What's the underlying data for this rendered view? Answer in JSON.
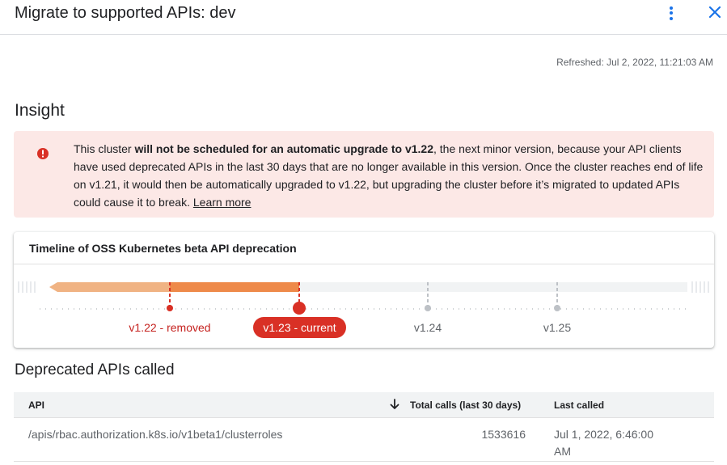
{
  "header": {
    "title": "Migrate to supported APIs: dev",
    "colors": {
      "accent": "#1a73e8"
    }
  },
  "refreshed": "Refreshed: Jul 2, 2022, 11:21:03 AM",
  "insight": {
    "title": "Insight",
    "alert": {
      "text_before": "This cluster ",
      "text_bold": "will not be scheduled for an automatic upgrade to v1.22",
      "text_after": ", the next minor version, because your API clients have used deprecated APIs in the last 30 days that are no longer available in this version. Once the cluster reaches end of life on v1.21, it would then be automatically upgraded to v1.22, but upgrading the cluster before it’s migrated to updated APIs could cause it to break. ",
      "link": "Learn more",
      "icon": "error-icon",
      "colors": {
        "background": "#fce8e6",
        "icon": "#d93025"
      }
    }
  },
  "timeline": {
    "title": "Timeline of OSS Kubernetes beta API deprecation",
    "versions": [
      {
        "label": "v1.22 - removed",
        "status": "removed"
      },
      {
        "label": "v1.23 - current",
        "status": "current"
      },
      {
        "label": "v1.24",
        "status": "future"
      },
      {
        "label": "v1.25",
        "status": "future"
      }
    ],
    "colors": {
      "removed": "#d93025",
      "bar_past": "#f0b383",
      "bar_active": "#ee8a4a",
      "future": "#bdc1c6"
    }
  },
  "deprecated": {
    "title": "Deprecated APIs called",
    "columns": {
      "api": "API",
      "calls": "Total calls (last 30 days)",
      "last": "Last called"
    },
    "sort_icon": "arrow-down-icon",
    "rows": [
      {
        "api": "/apis/rbac.authorization.k8s.io/v1beta1/clusterroles",
        "calls": "1533616",
        "last": "Jul 1, 2022, 6:46:00 AM"
      }
    ]
  }
}
